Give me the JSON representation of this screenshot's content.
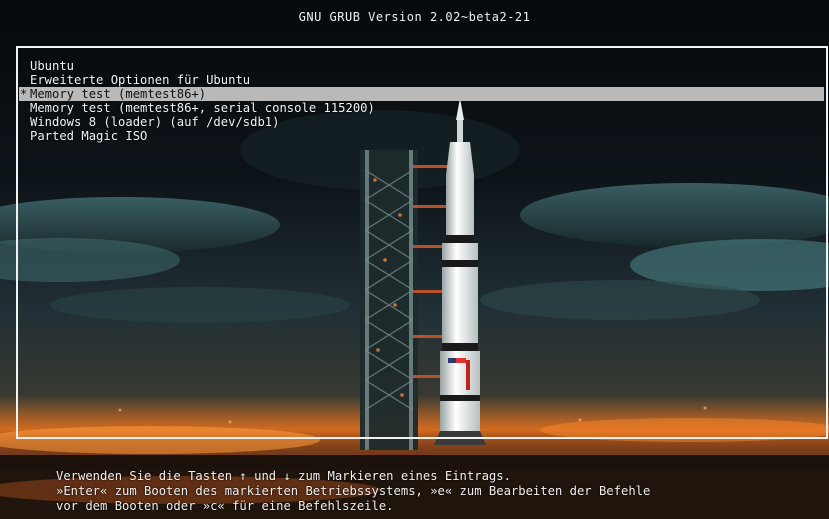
{
  "header": {
    "title": "GNU GRUB  Version 2.02~beta2-21"
  },
  "menu": {
    "items": [
      {
        "label": "Ubuntu",
        "selected": false
      },
      {
        "label": "Erweiterte Optionen für Ubuntu",
        "selected": false
      },
      {
        "label": "Memory test (memtest86+)",
        "selected": true,
        "marker": "*"
      },
      {
        "label": "Memory test (memtest86+, serial console 115200)",
        "selected": false
      },
      {
        "label": "Windows 8 (loader) (auf /dev/sdb1)",
        "selected": false
      },
      {
        "label": "Parted Magic ISO",
        "selected": false
      }
    ]
  },
  "help": {
    "line1": "Verwenden Sie die Tasten ↑ und ↓ zum Markieren eines Eintrags.",
    "line2": "»Enter« zum Booten des markierten Betriebssystems, »e« zum Bearbeiten der Befehle",
    "line3": "vor dem Booten oder »c« für eine Befehlszeile."
  },
  "colors": {
    "text": "#f2f2f2",
    "highlight_bg": "#b9b9b9",
    "highlight_text": "#111111",
    "frame": "#f2f2f2"
  }
}
